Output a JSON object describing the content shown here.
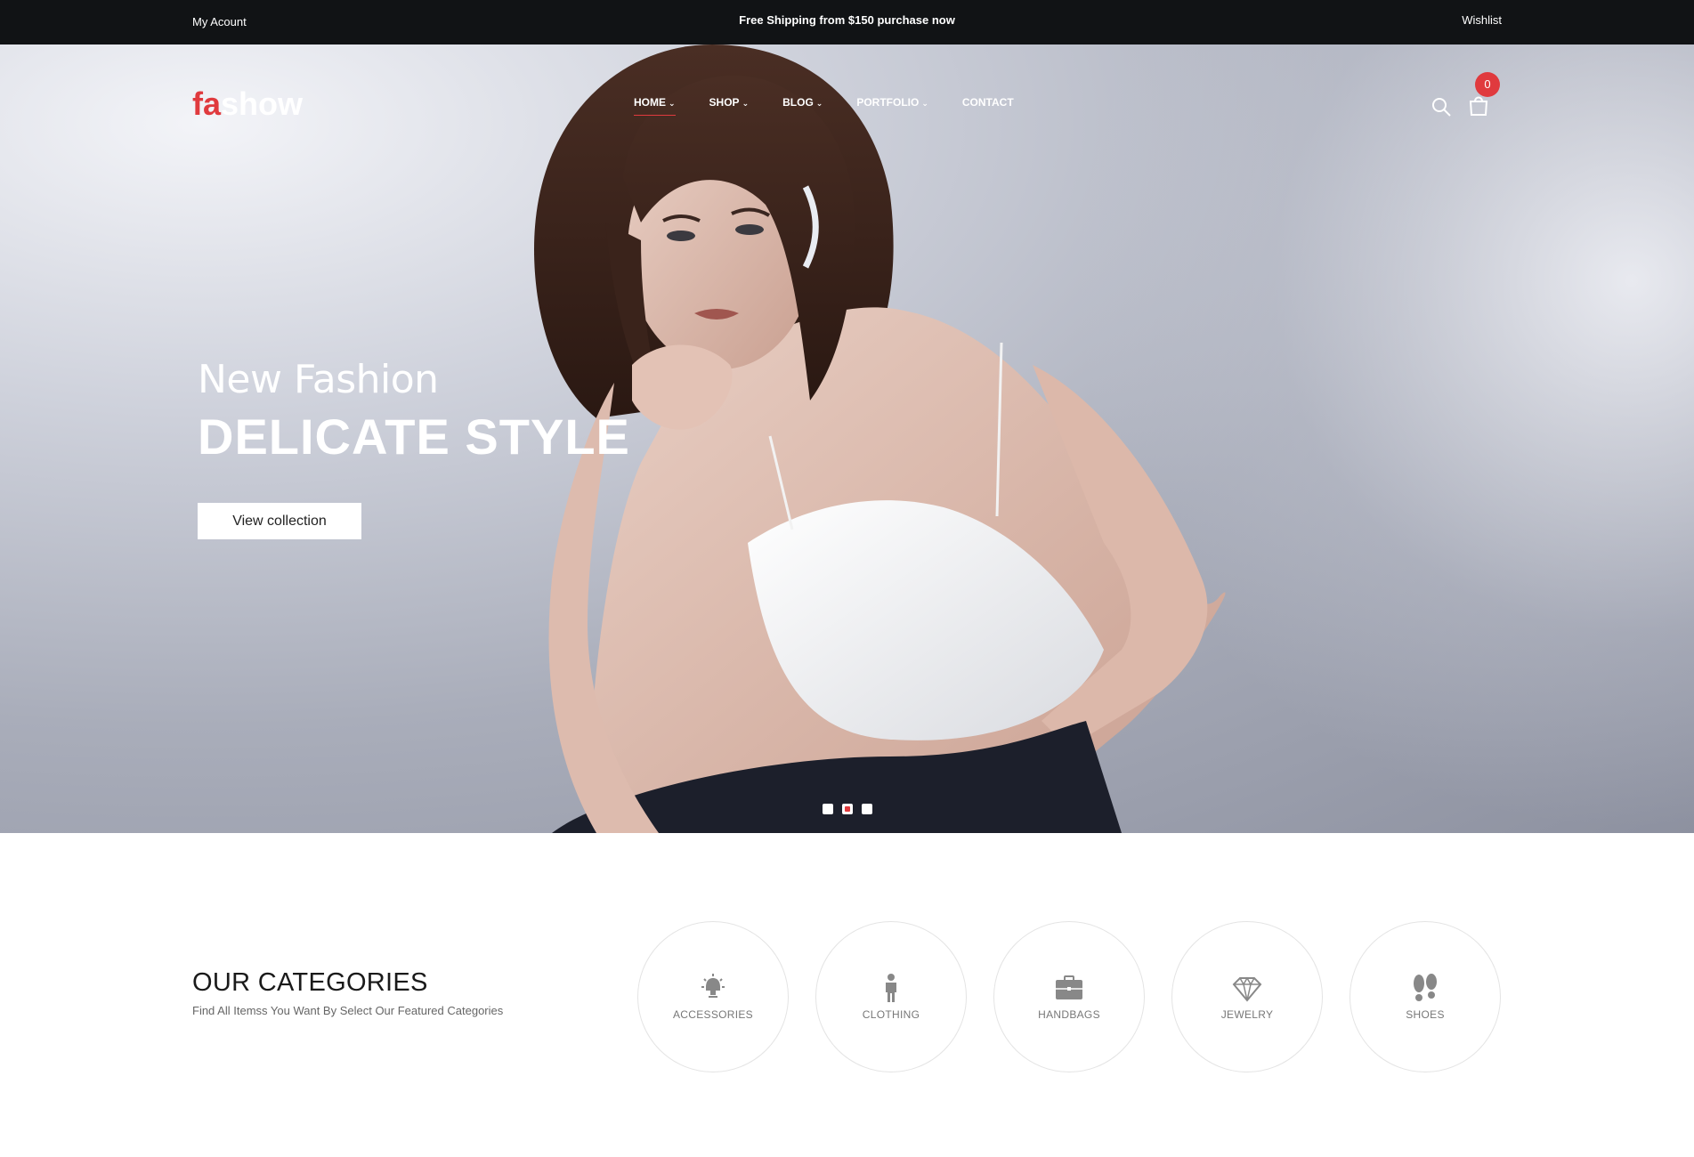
{
  "topbar": {
    "account": "My Acount",
    "promo": "Free Shipping from $150 purchase now",
    "wishlist": "Wishlist"
  },
  "brand": {
    "logo_part1": "fa",
    "logo_part2": "show",
    "accent": "#e03a3e"
  },
  "nav": {
    "items": [
      {
        "label": "HOME",
        "dropdown": true,
        "active": true
      },
      {
        "label": "SHOP",
        "dropdown": true
      },
      {
        "label": "BLOG",
        "dropdown": true
      },
      {
        "label": "PORTFOLIO",
        "dropdown": true
      },
      {
        "label": "CONTACT",
        "dropdown": false
      }
    ],
    "cart_count": "0"
  },
  "hero": {
    "subtitle": "New Fashion",
    "title": "DELICATE STYLE",
    "cta": "View collection",
    "slides": 3,
    "active_slide": 2
  },
  "categories": {
    "title": "OUR CATEGORIES",
    "subtitle": "Find All Itemss You Want By Select Our Featured Categories",
    "items": [
      {
        "label": "ACCESSORIES",
        "icon": "lamp-icon"
      },
      {
        "label": "CLOTHING",
        "icon": "person-icon"
      },
      {
        "label": "HANDBAGS",
        "icon": "briefcase-icon"
      },
      {
        "label": "JEWELRY",
        "icon": "diamond-icon"
      },
      {
        "label": "SHOES",
        "icon": "footprints-icon"
      }
    ]
  }
}
